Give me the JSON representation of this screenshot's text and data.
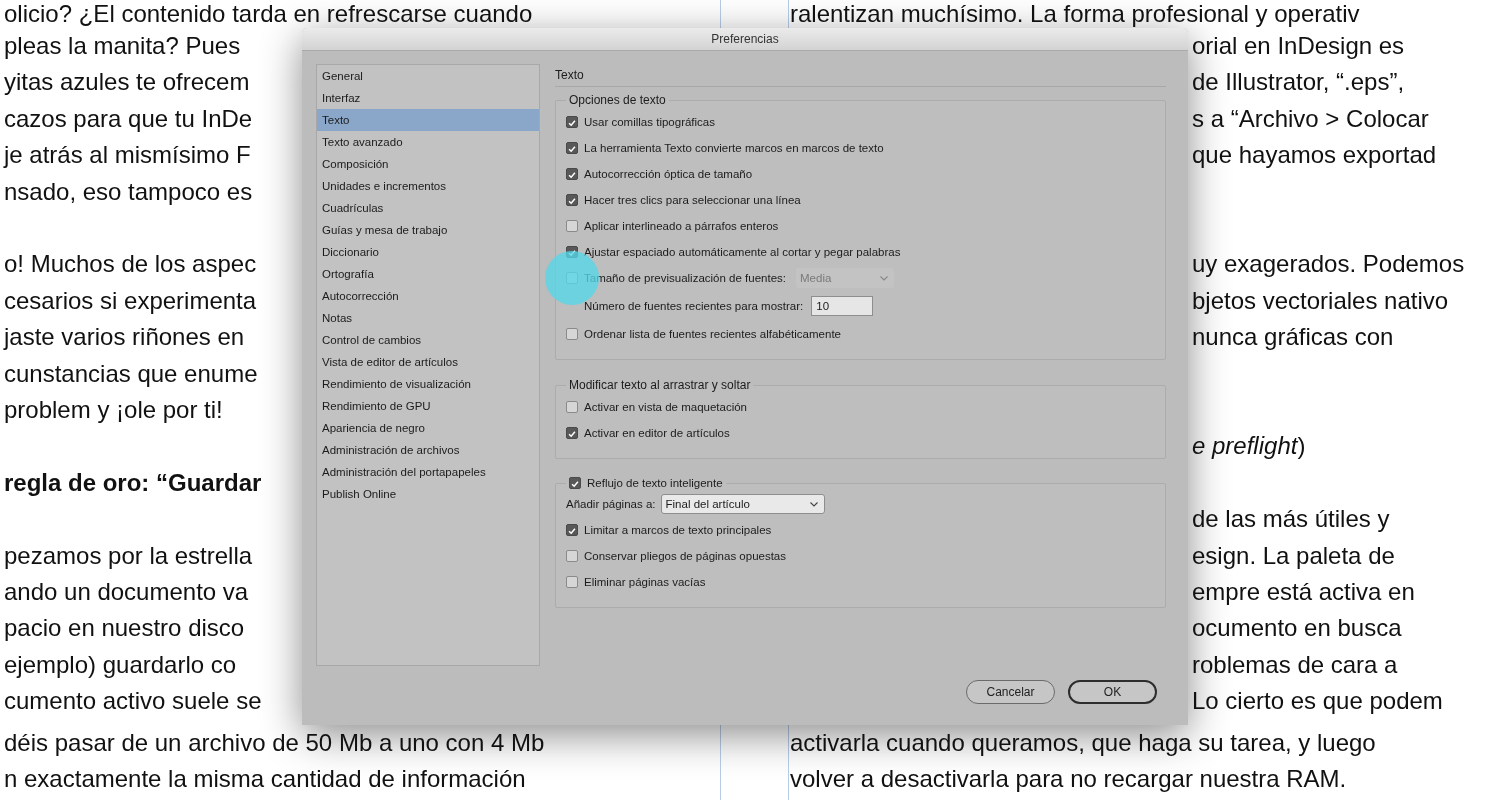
{
  "document": {
    "top_line": {
      "left": "olicio? ¿El contenido tarda en refrescarse cuando",
      "right": "ralentizan muchísimo. La forma profesional y operativ"
    },
    "left_paragraphs": [
      {
        "kind": "body",
        "lines": [
          "pleas la manita? Pues",
          "yitas azules te ofrecem",
          "cazos para que tu InDe",
          "je atrás al mismísimo F",
          "nsado, eso tampoco es"
        ]
      },
      {
        "kind": "body",
        "lines": [
          "o! Muchos de los aspec",
          "cesarios si experimenta",
          "jaste varios riñones en",
          "cunstancias que enume",
          "problem y ¡ole por ti!"
        ]
      },
      {
        "kind": "heading",
        "lines": [
          "regla de oro: “Guardar"
        ]
      },
      {
        "kind": "body",
        "lines": [
          "pezamos por la estrella",
          "ando un documento va",
          "pacio en nuestro disco",
          "ejemplo) guardarlo co",
          "cumento activo suele se"
        ]
      }
    ],
    "right_paragraphs": [
      {
        "lines": [
          "orial en InDesign es",
          "de Illustrator, “.eps”,",
          "s a “Archivo > Colocar",
          "que hayamos exportad"
        ]
      },
      {
        "lines": [
          "uy exagerados. Podemos",
          "bjetos vectoriales nativo",
          "nunca gráficas con"
        ]
      },
      {
        "lines": [
          "*e preflight*)"
        ]
      },
      {
        "lines": [
          "de las más útiles y",
          "esign. La paleta de",
          "empre está activa en",
          "ocumento en busca",
          "roblemas de cara a",
          "Lo cierto es que podem"
        ]
      }
    ],
    "bottom_lines": [
      {
        "left": "déis pasar de un archivo de 50 Mb a uno con 4 Mb",
        "right": "activarla cuando queramos, que haga su tarea, y luego"
      },
      {
        "left": "n exactamente la misma cantidad de información",
        "right": "volver a desactivarla para no recargar nuestra RAM."
      }
    ]
  },
  "dialog": {
    "title": "Preferencias",
    "categories": [
      {
        "label": "General",
        "selected": false
      },
      {
        "label": "Interfaz",
        "selected": false
      },
      {
        "label": "Texto",
        "selected": true
      },
      {
        "label": "Texto avanzado",
        "selected": false
      },
      {
        "label": "Composición",
        "selected": false
      },
      {
        "label": "Unidades e incrementos",
        "selected": false
      },
      {
        "label": "Cuadrículas",
        "selected": false
      },
      {
        "label": "Guías y mesa de trabajo",
        "selected": false
      },
      {
        "label": "Diccionario",
        "selected": false
      },
      {
        "label": "Ortografía",
        "selected": false
      },
      {
        "label": "Autocorrección",
        "selected": false
      },
      {
        "label": "Notas",
        "selected": false
      },
      {
        "label": "Control de cambios",
        "selected": false
      },
      {
        "label": "Vista de editor de artículos",
        "selected": false
      },
      {
        "label": "Rendimiento de visualización",
        "selected": false
      },
      {
        "label": "Rendimiento de GPU",
        "selected": false
      },
      {
        "label": "Apariencia de negro",
        "selected": false
      },
      {
        "label": "Administración de archivos",
        "selected": false
      },
      {
        "label": "Administración del portapapeles",
        "selected": false
      },
      {
        "label": "Publish Online",
        "selected": false
      }
    ],
    "section_title": "Texto",
    "groups": [
      {
        "kind": "plain",
        "title": "Opciones de texto",
        "rows": [
          {
            "kind": "checkbox",
            "label": "Usar comillas tipográficas",
            "checked": true
          },
          {
            "kind": "checkbox",
            "label": "La herramienta Texto convierte marcos en marcos de texto",
            "checked": true
          },
          {
            "kind": "checkbox",
            "label": "Autocorrección óptica de tamaño",
            "checked": true
          },
          {
            "kind": "checkbox",
            "label": "Hacer tres clics para seleccionar una línea",
            "checked": true
          },
          {
            "kind": "checkbox",
            "label": "Aplicar interlineado a párrafos enteros",
            "checked": false
          },
          {
            "kind": "checkbox",
            "label": "Ajustar espaciado automáticamente al cortar y pegar palabras",
            "checked": true
          },
          {
            "kind": "checkbox-select",
            "label": "Tamaño de previsualización de fuentes:",
            "checked": false,
            "select": {
              "value": "Media",
              "disabled": true
            }
          },
          {
            "kind": "number",
            "label": "Número de fuentes recientes para mostrar:",
            "value": "10"
          },
          {
            "kind": "checkbox",
            "label": "Ordenar lista de fuentes recientes alfabéticamente",
            "checked": false
          }
        ]
      },
      {
        "kind": "plain",
        "title": "Modificar texto al arrastrar y soltar",
        "rows": [
          {
            "kind": "checkbox",
            "label": "Activar en vista de maquetación",
            "checked": false
          },
          {
            "kind": "checkbox",
            "label": "Activar en editor de artículos",
            "checked": true
          }
        ]
      },
      {
        "kind": "checkbox-title",
        "title": "Reflujo de texto inteligente",
        "checked": true,
        "rows": [
          {
            "kind": "select",
            "label": "Añadir páginas a:",
            "select": {
              "value": "Final del artículo",
              "disabled": false
            }
          },
          {
            "kind": "checkbox",
            "label": "Limitar a marcos de texto principales",
            "checked": true
          },
          {
            "kind": "checkbox",
            "label": "Conservar pliegos de páginas opuestas",
            "checked": false
          },
          {
            "kind": "checkbox",
            "label": "Eliminar páginas vacías",
            "checked": false
          }
        ]
      }
    ],
    "buttons": [
      {
        "label": "Cancelar",
        "default": false
      },
      {
        "label": "OK",
        "default": true
      }
    ]
  }
}
